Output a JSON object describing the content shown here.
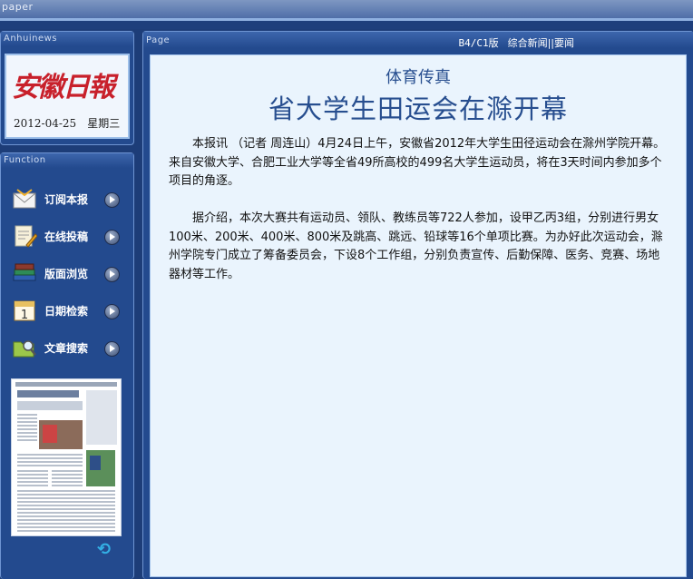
{
  "window": {
    "title": "paper"
  },
  "news_panel": {
    "header": "Anhuinews",
    "logo_text": "安徽日報",
    "date": "2012-04-25",
    "weekday": "星期三"
  },
  "function_panel": {
    "header": "Function",
    "items": [
      {
        "label": "订阅本报",
        "icon": "mail-icon"
      },
      {
        "label": "在线投稿",
        "icon": "edit-document-icon"
      },
      {
        "label": "版面浏览",
        "icon": "books-icon"
      },
      {
        "label": "日期检索",
        "icon": "calendar-icon"
      },
      {
        "label": "文章搜索",
        "icon": "search-folder-icon"
      }
    ],
    "thumbnail_icon": "newspaper-page-thumbnail",
    "refresh_icon": "refresh-icon"
  },
  "page_panel": {
    "header": "Page",
    "edition_code": "B4/C1版",
    "edition_name": "综合新闻||要闻"
  },
  "article": {
    "subhead": "体育传真",
    "headline": "省大学生田运会在滁开幕",
    "paragraphs": [
      "本报讯 （记者 周连山）4月24日上午，安徽省2012年大学生田径运动会在滁州学院开幕。来自安徽大学、合肥工业大学等全省49所高校的499名大学生运动员，将在3天时间内参加多个项目的角逐。",
      "据介绍，本次大赛共有运动员、领队、教练员等722人参加，设甲乙丙3组，分别进行男女100米、200米、400米、800米及跳高、跳远、铅球等16个单项比赛。为办好此次运动会，滁州学院专门成立了筹备委员会，下设8个工作组，分别负责宣传、后勤保障、医务、竞赛、场地器材等工作。"
    ]
  },
  "colors": {
    "background": "#1d3d78",
    "panel": "#234a8e",
    "article_bg": "#eaf4fd",
    "headline": "#274e8f",
    "logo_red": "#c8202b"
  }
}
